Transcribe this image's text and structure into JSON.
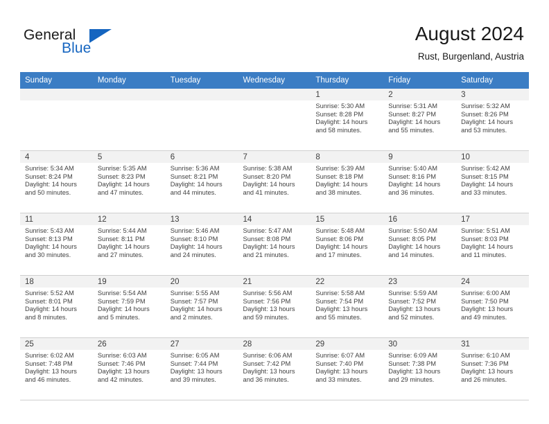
{
  "brand": {
    "name_part1": "General",
    "name_part2": "Blue",
    "triangle_icon": "triangle-logo-icon",
    "accent_color": "#1565c0"
  },
  "header": {
    "title": "August 2024",
    "location": "Rust, Burgenland, Austria"
  },
  "calendar": {
    "header_background": "#3b7dc4",
    "daynum_band_background": "#f2f2f2",
    "weekdays": [
      "Sunday",
      "Monday",
      "Tuesday",
      "Wednesday",
      "Thursday",
      "Friday",
      "Saturday"
    ],
    "weeks": [
      [
        {
          "day": "",
          "blank": true
        },
        {
          "day": "",
          "blank": true
        },
        {
          "day": "",
          "blank": true
        },
        {
          "day": "",
          "blank": true
        },
        {
          "day": "1",
          "sunrise": "Sunrise: 5:30 AM",
          "sunset": "Sunset: 8:28 PM",
          "daylight1": "Daylight: 14 hours",
          "daylight2": "and 58 minutes."
        },
        {
          "day": "2",
          "sunrise": "Sunrise: 5:31 AM",
          "sunset": "Sunset: 8:27 PM",
          "daylight1": "Daylight: 14 hours",
          "daylight2": "and 55 minutes."
        },
        {
          "day": "3",
          "sunrise": "Sunrise: 5:32 AM",
          "sunset": "Sunset: 8:26 PM",
          "daylight1": "Daylight: 14 hours",
          "daylight2": "and 53 minutes."
        }
      ],
      [
        {
          "day": "4",
          "sunrise": "Sunrise: 5:34 AM",
          "sunset": "Sunset: 8:24 PM",
          "daylight1": "Daylight: 14 hours",
          "daylight2": "and 50 minutes."
        },
        {
          "day": "5",
          "sunrise": "Sunrise: 5:35 AM",
          "sunset": "Sunset: 8:23 PM",
          "daylight1": "Daylight: 14 hours",
          "daylight2": "and 47 minutes."
        },
        {
          "day": "6",
          "sunrise": "Sunrise: 5:36 AM",
          "sunset": "Sunset: 8:21 PM",
          "daylight1": "Daylight: 14 hours",
          "daylight2": "and 44 minutes."
        },
        {
          "day": "7",
          "sunrise": "Sunrise: 5:38 AM",
          "sunset": "Sunset: 8:20 PM",
          "daylight1": "Daylight: 14 hours",
          "daylight2": "and 41 minutes."
        },
        {
          "day": "8",
          "sunrise": "Sunrise: 5:39 AM",
          "sunset": "Sunset: 8:18 PM",
          "daylight1": "Daylight: 14 hours",
          "daylight2": "and 38 minutes."
        },
        {
          "day": "9",
          "sunrise": "Sunrise: 5:40 AM",
          "sunset": "Sunset: 8:16 PM",
          "daylight1": "Daylight: 14 hours",
          "daylight2": "and 36 minutes."
        },
        {
          "day": "10",
          "sunrise": "Sunrise: 5:42 AM",
          "sunset": "Sunset: 8:15 PM",
          "daylight1": "Daylight: 14 hours",
          "daylight2": "and 33 minutes."
        }
      ],
      [
        {
          "day": "11",
          "sunrise": "Sunrise: 5:43 AM",
          "sunset": "Sunset: 8:13 PM",
          "daylight1": "Daylight: 14 hours",
          "daylight2": "and 30 minutes."
        },
        {
          "day": "12",
          "sunrise": "Sunrise: 5:44 AM",
          "sunset": "Sunset: 8:11 PM",
          "daylight1": "Daylight: 14 hours",
          "daylight2": "and 27 minutes."
        },
        {
          "day": "13",
          "sunrise": "Sunrise: 5:46 AM",
          "sunset": "Sunset: 8:10 PM",
          "daylight1": "Daylight: 14 hours",
          "daylight2": "and 24 minutes."
        },
        {
          "day": "14",
          "sunrise": "Sunrise: 5:47 AM",
          "sunset": "Sunset: 8:08 PM",
          "daylight1": "Daylight: 14 hours",
          "daylight2": "and 21 minutes."
        },
        {
          "day": "15",
          "sunrise": "Sunrise: 5:48 AM",
          "sunset": "Sunset: 8:06 PM",
          "daylight1": "Daylight: 14 hours",
          "daylight2": "and 17 minutes."
        },
        {
          "day": "16",
          "sunrise": "Sunrise: 5:50 AM",
          "sunset": "Sunset: 8:05 PM",
          "daylight1": "Daylight: 14 hours",
          "daylight2": "and 14 minutes."
        },
        {
          "day": "17",
          "sunrise": "Sunrise: 5:51 AM",
          "sunset": "Sunset: 8:03 PM",
          "daylight1": "Daylight: 14 hours",
          "daylight2": "and 11 minutes."
        }
      ],
      [
        {
          "day": "18",
          "sunrise": "Sunrise: 5:52 AM",
          "sunset": "Sunset: 8:01 PM",
          "daylight1": "Daylight: 14 hours",
          "daylight2": "and 8 minutes."
        },
        {
          "day": "19",
          "sunrise": "Sunrise: 5:54 AM",
          "sunset": "Sunset: 7:59 PM",
          "daylight1": "Daylight: 14 hours",
          "daylight2": "and 5 minutes."
        },
        {
          "day": "20",
          "sunrise": "Sunrise: 5:55 AM",
          "sunset": "Sunset: 7:57 PM",
          "daylight1": "Daylight: 14 hours",
          "daylight2": "and 2 minutes."
        },
        {
          "day": "21",
          "sunrise": "Sunrise: 5:56 AM",
          "sunset": "Sunset: 7:56 PM",
          "daylight1": "Daylight: 13 hours",
          "daylight2": "and 59 minutes."
        },
        {
          "day": "22",
          "sunrise": "Sunrise: 5:58 AM",
          "sunset": "Sunset: 7:54 PM",
          "daylight1": "Daylight: 13 hours",
          "daylight2": "and 55 minutes."
        },
        {
          "day": "23",
          "sunrise": "Sunrise: 5:59 AM",
          "sunset": "Sunset: 7:52 PM",
          "daylight1": "Daylight: 13 hours",
          "daylight2": "and 52 minutes."
        },
        {
          "day": "24",
          "sunrise": "Sunrise: 6:00 AM",
          "sunset": "Sunset: 7:50 PM",
          "daylight1": "Daylight: 13 hours",
          "daylight2": "and 49 minutes."
        }
      ],
      [
        {
          "day": "25",
          "sunrise": "Sunrise: 6:02 AM",
          "sunset": "Sunset: 7:48 PM",
          "daylight1": "Daylight: 13 hours",
          "daylight2": "and 46 minutes."
        },
        {
          "day": "26",
          "sunrise": "Sunrise: 6:03 AM",
          "sunset": "Sunset: 7:46 PM",
          "daylight1": "Daylight: 13 hours",
          "daylight2": "and 42 minutes."
        },
        {
          "day": "27",
          "sunrise": "Sunrise: 6:05 AM",
          "sunset": "Sunset: 7:44 PM",
          "daylight1": "Daylight: 13 hours",
          "daylight2": "and 39 minutes."
        },
        {
          "day": "28",
          "sunrise": "Sunrise: 6:06 AM",
          "sunset": "Sunset: 7:42 PM",
          "daylight1": "Daylight: 13 hours",
          "daylight2": "and 36 minutes."
        },
        {
          "day": "29",
          "sunrise": "Sunrise: 6:07 AM",
          "sunset": "Sunset: 7:40 PM",
          "daylight1": "Daylight: 13 hours",
          "daylight2": "and 33 minutes."
        },
        {
          "day": "30",
          "sunrise": "Sunrise: 6:09 AM",
          "sunset": "Sunset: 7:38 PM",
          "daylight1": "Daylight: 13 hours",
          "daylight2": "and 29 minutes."
        },
        {
          "day": "31",
          "sunrise": "Sunrise: 6:10 AM",
          "sunset": "Sunset: 7:36 PM",
          "daylight1": "Daylight: 13 hours",
          "daylight2": "and 26 minutes."
        }
      ]
    ]
  }
}
